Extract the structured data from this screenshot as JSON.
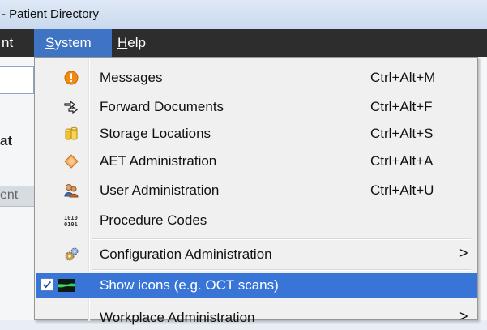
{
  "window": {
    "title": "- Patient Directory"
  },
  "menubar": {
    "partial_item": "nt",
    "system_first": "S",
    "system_rest": "ystem",
    "help_first": "H",
    "help_rest": "elp"
  },
  "background": {
    "partial_heading": "at",
    "partial_tab": "ent"
  },
  "menu": {
    "items": [
      {
        "label": "Messages",
        "shortcut": "Ctrl+Alt+M",
        "icon": "warning-circle-icon"
      },
      {
        "label": "Forward Documents",
        "shortcut": "Ctrl+Alt+F",
        "icon": "forward-arrows-icon"
      },
      {
        "label": "Storage Locations",
        "shortcut": "Ctrl+Alt+S",
        "icon": "storage-cylinders-icon"
      },
      {
        "label": "AET Administration",
        "shortcut": "Ctrl+Alt+A",
        "icon": "diamond-tag-icon"
      },
      {
        "label": "User Administration",
        "shortcut": "Ctrl+Alt+U",
        "icon": "users-icon"
      },
      {
        "label": "Procedure Codes",
        "shortcut": "",
        "icon": "binary-code-icon"
      },
      {
        "label": "Configuration Administration",
        "arrow": ">",
        "icon": "gears-icon"
      },
      {
        "label": "Show icons (e.g. OCT scans)",
        "checked": true,
        "icon": "oct-scan-icon"
      },
      {
        "label": "Workplace Administration",
        "arrow": ">"
      }
    ]
  },
  "colors": {
    "highlight": "#3875d7",
    "menubar": "#2d2d2d",
    "active_menu": "#3f74c4"
  }
}
